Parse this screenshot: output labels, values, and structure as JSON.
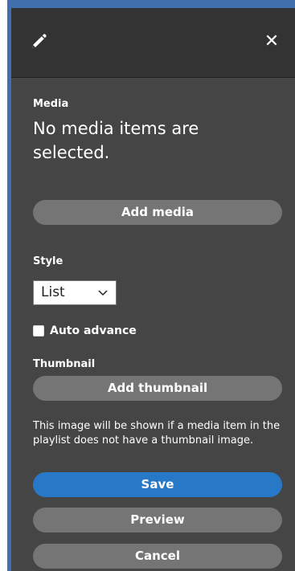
{
  "header": {
    "pencil_icon": "pencil-icon",
    "close_icon": "close-icon",
    "close_glyph": "✕"
  },
  "media": {
    "label": "Media",
    "empty_message": "No media items are selected.",
    "add_button": "Add media"
  },
  "style": {
    "label": "Style",
    "selected_value": "List"
  },
  "auto_advance": {
    "label": "Auto advance",
    "checked": false
  },
  "thumbnail": {
    "label": "Thumbnail",
    "add_button": "Add thumbnail",
    "help_text": "This image will be shown if a media item in the playlist does not have a thumbnail image."
  },
  "actions": {
    "save": "Save",
    "preview": "Preview",
    "cancel": "Cancel"
  },
  "colors": {
    "panel_background": "#454545",
    "header_background": "#333333",
    "primary_button": "#2779c8",
    "secondary_button": "#757575",
    "frame_accent": "#3f6fad"
  }
}
